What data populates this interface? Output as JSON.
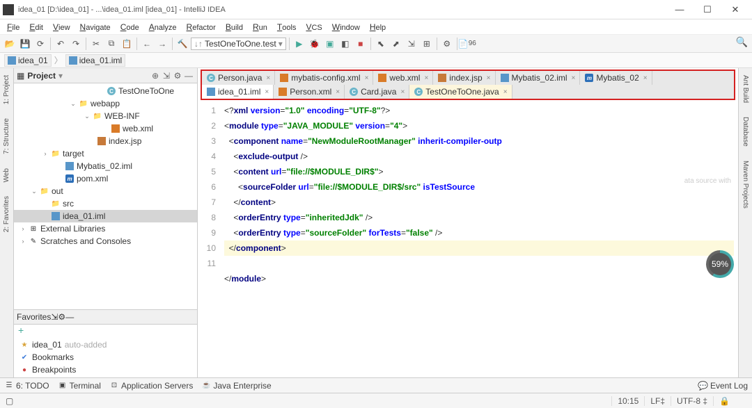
{
  "title": "idea_01 [D:\\idea_01] - ...\\idea_01.iml [idea_01] - IntelliJ IDEA",
  "menus": [
    "File",
    "Edit",
    "View",
    "Navigate",
    "Code",
    "Analyze",
    "Refactor",
    "Build",
    "Run",
    "Tools",
    "VCS",
    "Window",
    "Help"
  ],
  "run_config": "TestOneToOne.test",
  "breadcrumbs": [
    "idea_01",
    "idea_01.iml"
  ],
  "project_panel_title": "Project",
  "tree": [
    {
      "indent": 120,
      "icon": "class",
      "label": "TestOneToOne"
    },
    {
      "indent": 80,
      "arrow": "v",
      "icon": "folder",
      "label": "webapp"
    },
    {
      "indent": 100,
      "arrow": "v",
      "icon": "folder",
      "label": "WEB-INF"
    },
    {
      "indent": 126,
      "icon": "xml",
      "label": "web.xml"
    },
    {
      "indent": 106,
      "icon": "jsp",
      "label": "index.jsp"
    },
    {
      "indent": 40,
      "arrow": ">",
      "icon": "folder-y",
      "label": "target"
    },
    {
      "indent": 60,
      "icon": "iml",
      "label": "Mybatis_02.iml"
    },
    {
      "indent": 60,
      "icon": "m",
      "label": "pom.xml"
    },
    {
      "indent": 24,
      "arrow": "v",
      "icon": "folder-y",
      "label": "out"
    },
    {
      "indent": 40,
      "icon": "folder",
      "label": "src"
    },
    {
      "indent": 40,
      "icon": "iml",
      "label": "idea_01.iml",
      "sel": true
    },
    {
      "indent": 8,
      "arrow": ">",
      "icon": "lib",
      "label": "External Libraries"
    },
    {
      "indent": 8,
      "arrow": ">",
      "icon": "scratch",
      "label": "Scratches and Consoles"
    }
  ],
  "favorites_title": "Favorites",
  "favorites": [
    {
      "icon": "star",
      "label": "idea_01",
      "note": "auto-added"
    },
    {
      "icon": "bookmark",
      "label": "Bookmarks"
    },
    {
      "icon": "breakpoint",
      "label": "Breakpoints"
    }
  ],
  "add_label": "+",
  "left_tabs": [
    "1: Project",
    "7: Structure",
    "Web",
    "2: Favorites"
  ],
  "right_tabs": [
    "Ant Build",
    "Database",
    "Maven Projects"
  ],
  "editor_tabs_row1": [
    {
      "icon": "class",
      "label": "Person.java"
    },
    {
      "icon": "xml",
      "label": "mybatis-config.xml"
    },
    {
      "icon": "xml",
      "label": "web.xml"
    },
    {
      "icon": "jsp",
      "label": "index.jsp"
    },
    {
      "icon": "iml",
      "label": "Mybatis_02.iml"
    },
    {
      "icon": "m",
      "label": "Mybatis_02"
    }
  ],
  "editor_tabs_row2": [
    {
      "icon": "iml",
      "label": "idea_01.iml",
      "current": true
    },
    {
      "icon": "xml",
      "label": "Person.xml"
    },
    {
      "icon": "class",
      "label": "Card.java"
    },
    {
      "icon": "class",
      "label": "TestOneToOne.java",
      "active": true
    }
  ],
  "line_count": 11,
  "gauge": "59%",
  "watermark": "ata source with",
  "bottom_tabs": [
    {
      "icon": "todo",
      "label": "6: TODO"
    },
    {
      "icon": "terminal",
      "label": "Terminal"
    },
    {
      "icon": "appsrv",
      "label": "Application Servers"
    },
    {
      "icon": "java",
      "label": "Java Enterprise"
    }
  ],
  "event_log": "Event Log",
  "status": {
    "pos": "10:15",
    "lf": "LF‡",
    "enc": "UTF-8 ‡",
    "lock": "🔒"
  }
}
